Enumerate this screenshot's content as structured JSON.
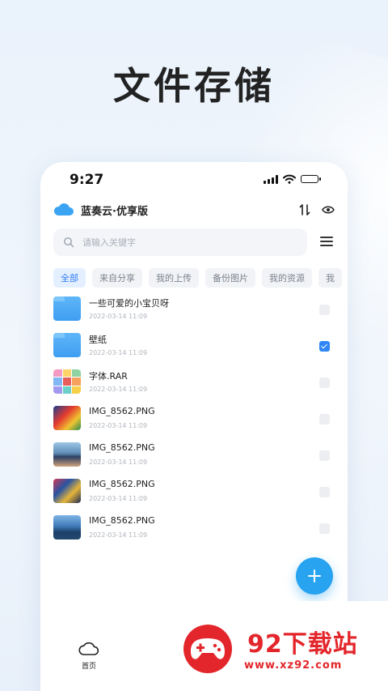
{
  "promo": {
    "title": "文件存储"
  },
  "status_bar": {
    "time": "9:27"
  },
  "app": {
    "name": "蓝奏云·优享版"
  },
  "search": {
    "placeholder": "请输入关键字"
  },
  "tabs": [
    "全部",
    "来自分享",
    "我的上传",
    "备份图片",
    "我的资源",
    "我"
  ],
  "files": [
    {
      "name": "一些可爱的小宝贝呀",
      "date": "2022-03-14 11:09",
      "type": "folder",
      "checked": false
    },
    {
      "name": "壁纸",
      "date": "2022-03-14 11:09",
      "type": "folder",
      "checked": true
    },
    {
      "name": "字体.RAR",
      "date": "2022-03-14 11:09",
      "type": "archive",
      "checked": false
    },
    {
      "name": "IMG_8562.PNG",
      "date": "2022-03-14 11:09",
      "type": "image",
      "checked": false
    },
    {
      "name": "IMG_8562.PNG",
      "date": "2022-03-14 11:09",
      "type": "image",
      "checked": false
    },
    {
      "name": "IMG_8562.PNG",
      "date": "2022-03-14 11:09",
      "type": "image",
      "checked": false
    },
    {
      "name": "IMG_8562.PNG",
      "date": "2022-03-14 11:09",
      "type": "image",
      "checked": false
    }
  ],
  "bottom_nav": {
    "home_label": "首页"
  },
  "watermark": {
    "name": "92下载站",
    "url": "www.xz92.com"
  },
  "icons": {
    "header_left": "cloud-logo-icon",
    "sort": "sort-arrows-icon",
    "visibility": "eye-icon",
    "search": "search-icon",
    "menu": "menu-icon",
    "fab": "plus-icon",
    "nav_home": "cloud-icon"
  },
  "colors": {
    "accent": "#2f86f6",
    "fab": "#27a3f0",
    "watermark": "#e3262b"
  }
}
